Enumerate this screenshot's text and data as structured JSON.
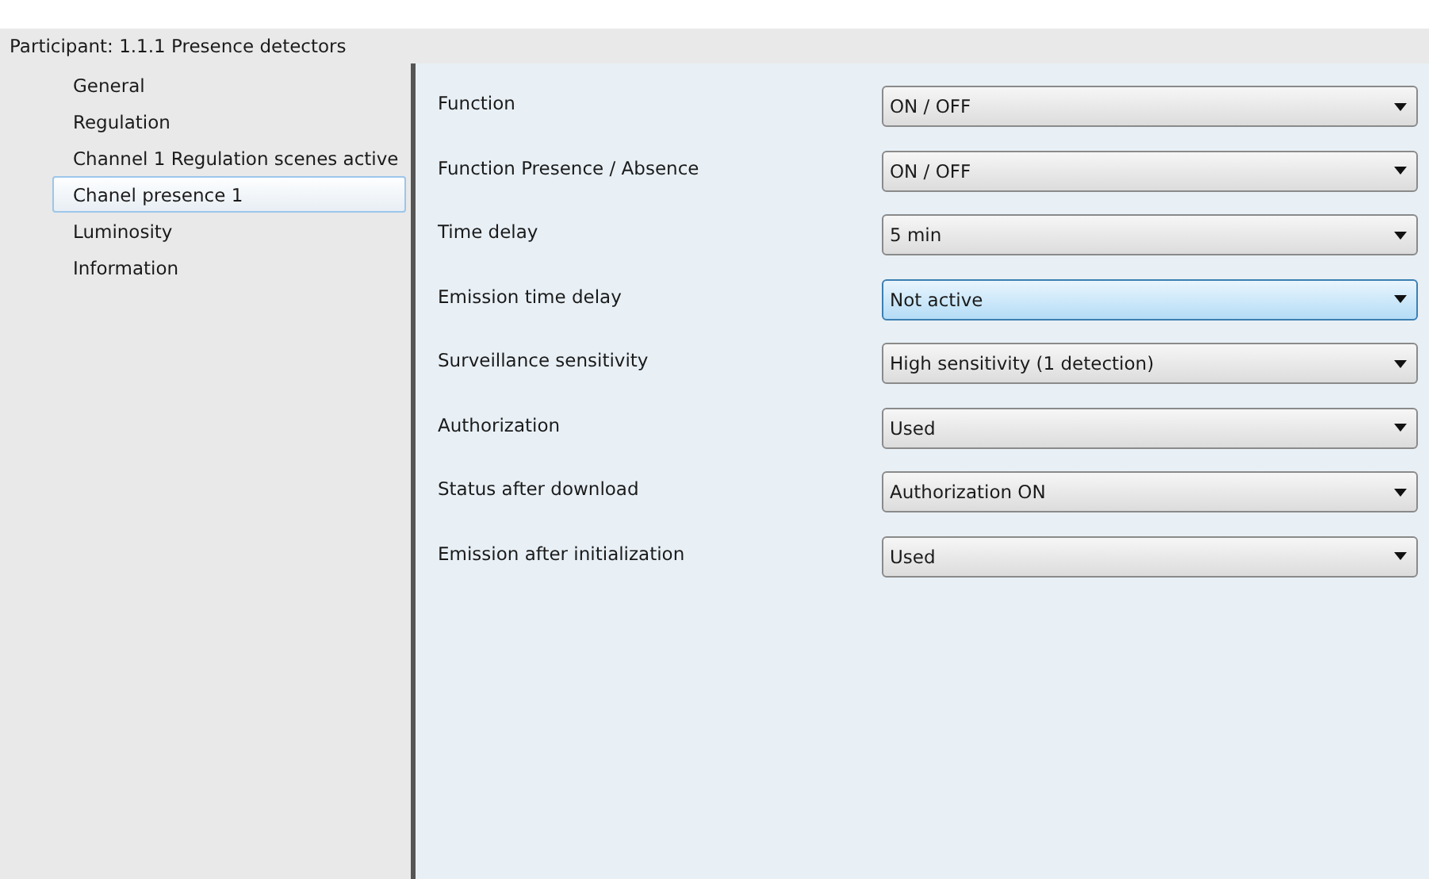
{
  "header": {
    "title": "Participant: 1.1.1  Presence detectors"
  },
  "sidebar": {
    "items": [
      {
        "label": "General",
        "selected": false
      },
      {
        "label": "Regulation",
        "selected": false
      },
      {
        "label": "Channel 1 Regulation scenes active",
        "selected": false
      },
      {
        "label": "Chanel presence 1",
        "selected": true
      },
      {
        "label": "Luminosity",
        "selected": false
      },
      {
        "label": "Information",
        "selected": false
      }
    ]
  },
  "parameters": [
    {
      "label": "Function",
      "value": "ON / OFF",
      "focused": false
    },
    {
      "label": "Function Presence / Absence",
      "value": "ON / OFF",
      "focused": false
    },
    {
      "label": "Time delay",
      "value": "5 min",
      "focused": false
    },
    {
      "label": "Emission time delay",
      "value": "Not active",
      "focused": true
    },
    {
      "label": "Surveillance sensitivity",
      "value": "High sensitivity (1 detection)",
      "focused": false
    },
    {
      "label": "Authorization",
      "value": "Used",
      "focused": false
    },
    {
      "label": "Status after download",
      "value": "Authorization ON",
      "focused": false
    },
    {
      "label": "Emission after initialization",
      "value": "Used",
      "focused": false
    }
  ]
}
